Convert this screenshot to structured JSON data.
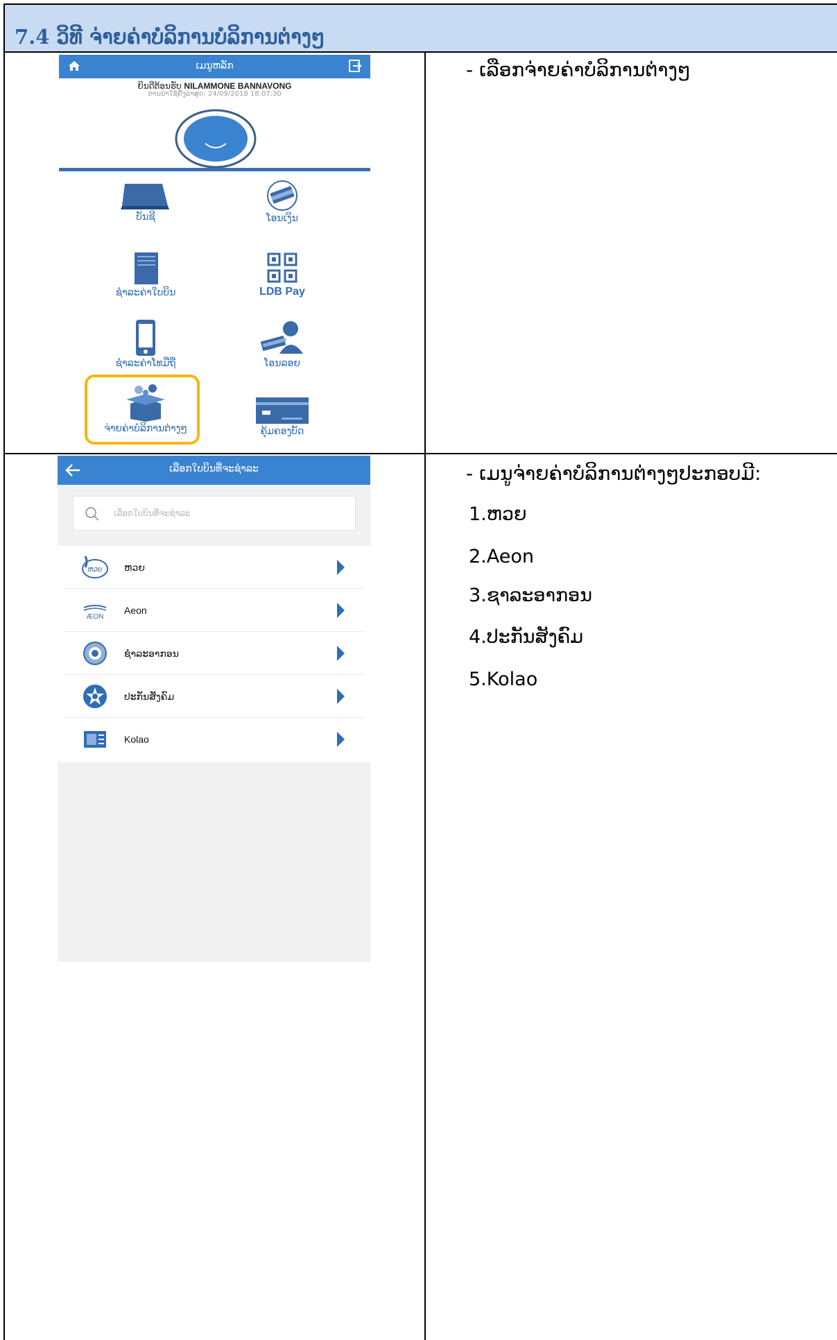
{
  "doc": {
    "heading": "7.4 ວິທີ ຈ່າຍຄ່າບໍລິການບໍລິການຕ່າງໆ",
    "row1_note": "-   ເລືອກຈ່າຍຄ່າບໍລິການຕ່າງໆ",
    "row2_intro": "-   ເມນູຈ່າຍຄ່າບໍລິການຕ່າງໆປະກອບມີ:",
    "row2_items": [
      "1.ຫວຍ",
      "2.Aeon",
      "3.ຊາລະອາກອນ",
      "4.ປະກັນສັງຄົມ",
      "5.Kolao"
    ]
  },
  "app_menu": {
    "title": "ເມນູຫລັກ",
    "welcome_prefix": "ຍິນດີຕ້ອນຮັບ",
    "user_name": "NILAMMONE BANNAVONG",
    "last_login": "ການນໍາໃຊ້ຄັ້ງລ່າສຸດ: 24/09/2018 18:07:30",
    "tiles": [
      "ບັນຊີ",
      "ໂອນເງິນ",
      "ຊໍາລະຄ່າໃບບິນ",
      "LDB Pay",
      "ຊໍາລະຄ່າໂທມືຖື",
      "ໂອນລອຍ",
      "ຈ່າຍຄ່າບໍລິການຕ່າງໆ",
      "ຄຸ້ມຄອງບັດ"
    ]
  },
  "bill_screen": {
    "title": "ເລືອກໃບບິນທີ່ຈະຊໍາລະ",
    "search_placeholder": "ເລືອກໃບບິນທີ່ຈະຊໍາລະ",
    "logo_text": "ຫວຍ",
    "aeon_logo": "ÆON",
    "items": [
      "ຫວຍ",
      "Aeon",
      "ຊໍາລະອາກອນ",
      "ປະກັນສັງຄົມ",
      "Kolao"
    ]
  },
  "colors": {
    "accent": "#3a83d0",
    "highlight": "#f7b70f",
    "header_bg": "#c9dbf2"
  }
}
